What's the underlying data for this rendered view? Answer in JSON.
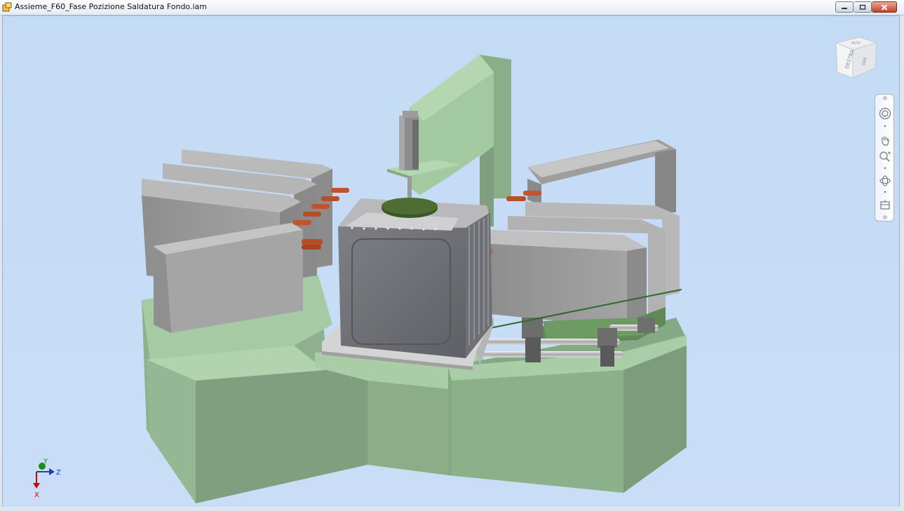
{
  "window": {
    "title": "Assieme_F60_Fase Pozizione Saldatura Fondo.iam",
    "app_icon": "inventor-assembly-icon",
    "controls": [
      "minimize-icon",
      "maximize-icon",
      "close-icon"
    ]
  },
  "viewcube": {
    "face_right": "DESTRA",
    "face_front": "DAV",
    "face_top": "ALTO"
  },
  "navigation_bar": {
    "tools": [
      "steering-wheel-icon",
      "pan-icon",
      "zoom-icon",
      "orbit-icon",
      "look-at-icon"
    ]
  },
  "axis_triad": {
    "y_label": "Y",
    "z_label": "Z",
    "x_label": "X"
  },
  "colors": {
    "background": "#c5dbf4",
    "fixture_green": "#9ec79c",
    "part_gray": "#9a9a9a",
    "contact_orange": "#c0542e"
  }
}
